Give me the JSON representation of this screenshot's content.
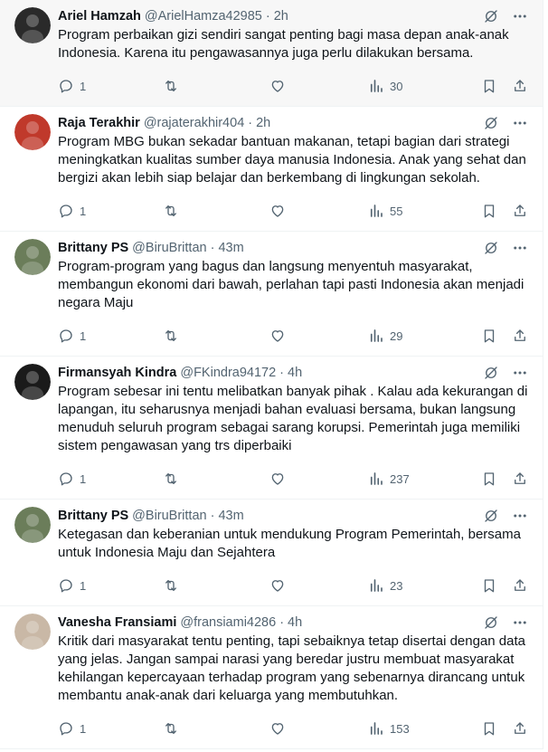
{
  "tweets": [
    {
      "name": "Ariel Hamzah",
      "handle": "@ArielHamza42985",
      "time": "2h",
      "text": "Program perbaikan gizi sendiri sangat penting bagi masa depan anak-anak Indonesia. Karena itu pengawasannya juga perlu dilakukan bersama.",
      "replies": "1",
      "reposts": "",
      "likes": "",
      "views": "30",
      "avatar_color": "#2a2a2a"
    },
    {
      "name": "Raja Terakhir",
      "handle": "@rajaterakhir404",
      "time": "2h",
      "text": "Program MBG bukan sekadar bantuan makanan, tetapi bagian dari strategi meningkatkan kualitas sumber daya manusia Indonesia. Anak yang sehat dan bergizi akan lebih siap belajar dan berkembang di lingkungan sekolah.",
      "replies": "1",
      "reposts": "",
      "likes": "",
      "views": "55",
      "avatar_color": "#c0392b"
    },
    {
      "name": "Brittany PS",
      "handle": "@BiruBrittan",
      "time": "43m",
      "text": "Program-program yang bagus dan langsung menyentuh masyarakat, membangun ekonomi dari bawah, perlahan tapi pasti Indonesia akan menjadi negara Maju",
      "replies": "1",
      "reposts": "",
      "likes": "",
      "views": "29",
      "avatar_color": "#6b7d5a"
    },
    {
      "name": "Firmansyah Kindra",
      "handle": "@FKindra94172",
      "time": "4h",
      "text": "Program sebesar ini tentu melibatkan banyak pihak . Kalau ada kekurangan di lapangan, itu seharusnya menjadi bahan evaluasi bersama, bukan langsung menuduh seluruh program sebagai sarang korupsi. Pemerintah juga memiliki sistem pengawasan yang trs diperbaiki",
      "replies": "1",
      "reposts": "",
      "likes": "",
      "views": "237",
      "avatar_color": "#1a1a1a"
    },
    {
      "name": "Brittany PS",
      "handle": "@BiruBrittan",
      "time": "43m",
      "text": "Ketegasan dan keberanian untuk mendukung Program Pemerintah, bersama untuk Indonesia Maju dan Sejahtera",
      "replies": "1",
      "reposts": "",
      "likes": "",
      "views": "23",
      "avatar_color": "#6b7d5a"
    },
    {
      "name": "Vanesha Fransiami",
      "handle": "@fransiami4286",
      "time": "4h",
      "text": "Kritik dari masyarakat tentu penting, tapi sebaiknya tetap disertai dengan data yang jelas. Jangan sampai narasi yang beredar justru membuat masyarakat kehilangan kepercayaan terhadap program yang sebenarnya dirancang untuk membantu anak-anak dari keluarga yang membutuhkan.",
      "replies": "1",
      "reposts": "",
      "likes": "",
      "views": "153",
      "avatar_color": "#c9b8a6"
    }
  ]
}
